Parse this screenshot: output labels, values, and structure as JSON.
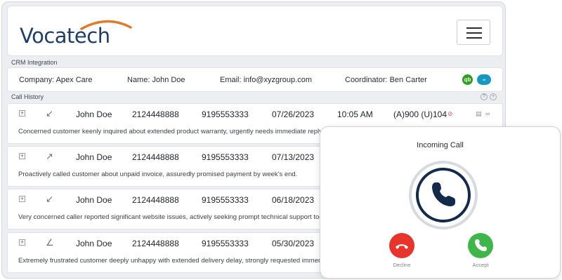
{
  "brand": {
    "name": "Vocatech",
    "swoosh_color": "#e07b2a",
    "text_color": "#1f3f66"
  },
  "header": {
    "menu_icon": "hamburger-menu-icon"
  },
  "crm": {
    "section_label": "CRM Integration",
    "company": "Company: Apex Care",
    "name": "Name: John Doe",
    "email": "Email: info@xyzgroup.com",
    "coordinator": "Coordinator: Ben Carter",
    "integrations": [
      {
        "icon": "quickbooks-icon",
        "label": "qb",
        "color": "#2ca01c"
      },
      {
        "icon": "salesforce-icon",
        "label": "salesforce",
        "color": "#1798c1"
      }
    ]
  },
  "history": {
    "section_label": "Call History",
    "header_icons": [
      "help-icon",
      "add-icon"
    ],
    "calls": [
      {
        "direction_icon": "incoming-call-arrow-icon",
        "arrow": "↙",
        "name": "John Doe",
        "from": "2124448888",
        "to": "9195553333",
        "date": "07/26/2023",
        "time": "10:05 AM",
        "ext": "(A)900 (U)104",
        "note": "Concerned customer keenly inquired about extended product warranty, urgently needs immediate reply."
      },
      {
        "direction_icon": "outgoing-call-arrow-icon",
        "arrow": "↗",
        "name": "John Doe",
        "from": "2124448888",
        "to": "9195553333",
        "date": "07/13/2023",
        "time": "",
        "ext": "",
        "note": "Proactively called customer about unpaid invoice, assuredly promised payment by week's end."
      },
      {
        "direction_icon": "incoming-call-arrow-icon",
        "arrow": "↙",
        "name": "John Doe",
        "from": "2124448888",
        "to": "9195553333",
        "date": "06/18/2023",
        "time": "",
        "ext": "",
        "note": "Very concerned caller reported significant website issues, actively seeking prompt technical support today."
      },
      {
        "direction_icon": "missed-call-arrow-icon",
        "arrow": "∠",
        "name": "John Doe",
        "from": "2124448888",
        "to": "9195553333",
        "date": "05/30/2023",
        "time": "",
        "ext": "",
        "note": "Extremely frustrated customer deeply unhappy with extended delivery delay, strongly requested immediate refund."
      }
    ]
  },
  "incoming": {
    "title": "Incoming Call",
    "decline_label": "Decline",
    "accept_label": "Accept",
    "decline_color": "#e8352b",
    "accept_color": "#3fb64a"
  }
}
